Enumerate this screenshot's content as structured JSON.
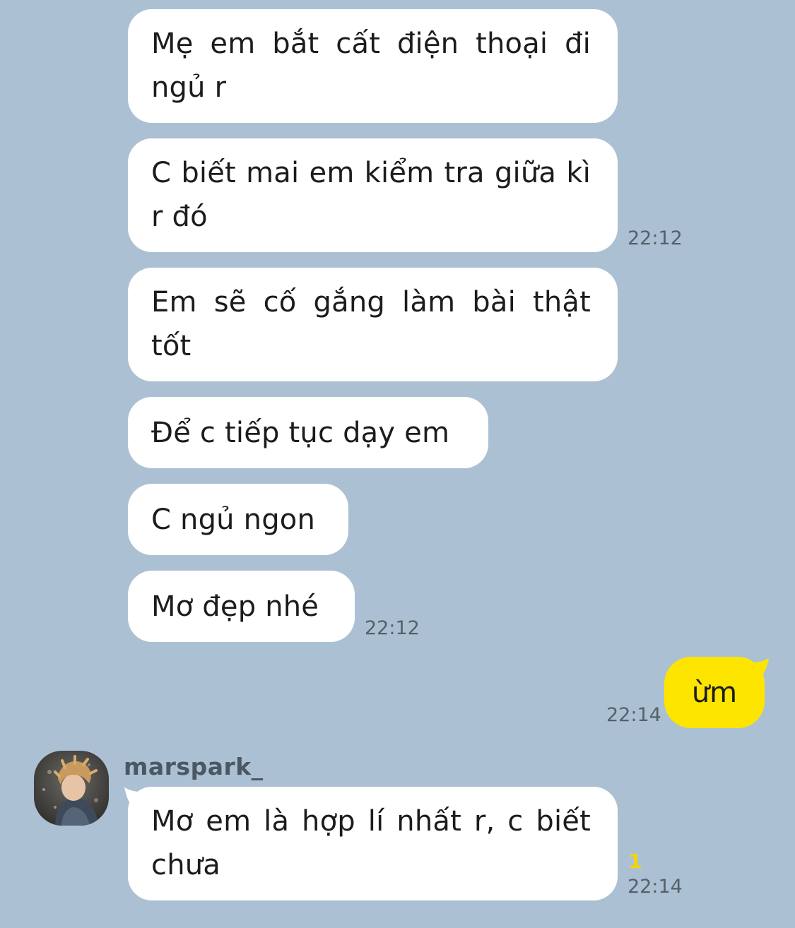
{
  "messages": {
    "m1": "Mẹ em bắt cất điện thoại đi ngủ r",
    "m2": "C biết mai em kiểm tra giữa kì r đó",
    "m2_time": "22:12",
    "m3": "Em sẽ cố gắng làm bài thật tốt",
    "m4": "Để c tiếp tục dạy em",
    "m5": "C ngủ ngon",
    "m6": "Mơ đẹp nhé",
    "m6_time": "22:12",
    "out1": "ừm",
    "out1_time": "22:14",
    "sender": "marspark_",
    "m7": "Mơ em là hợp lí nhất r, c biết chưa",
    "m7_unread": "1",
    "m7_time": "22:14"
  },
  "colors": {
    "background": "#abc1d3",
    "incoming_bubble": "#ffffff",
    "outgoing_bubble": "#fee500",
    "unread_count": "#f5d500"
  },
  "icons": {
    "avatar": "profile-photo"
  }
}
